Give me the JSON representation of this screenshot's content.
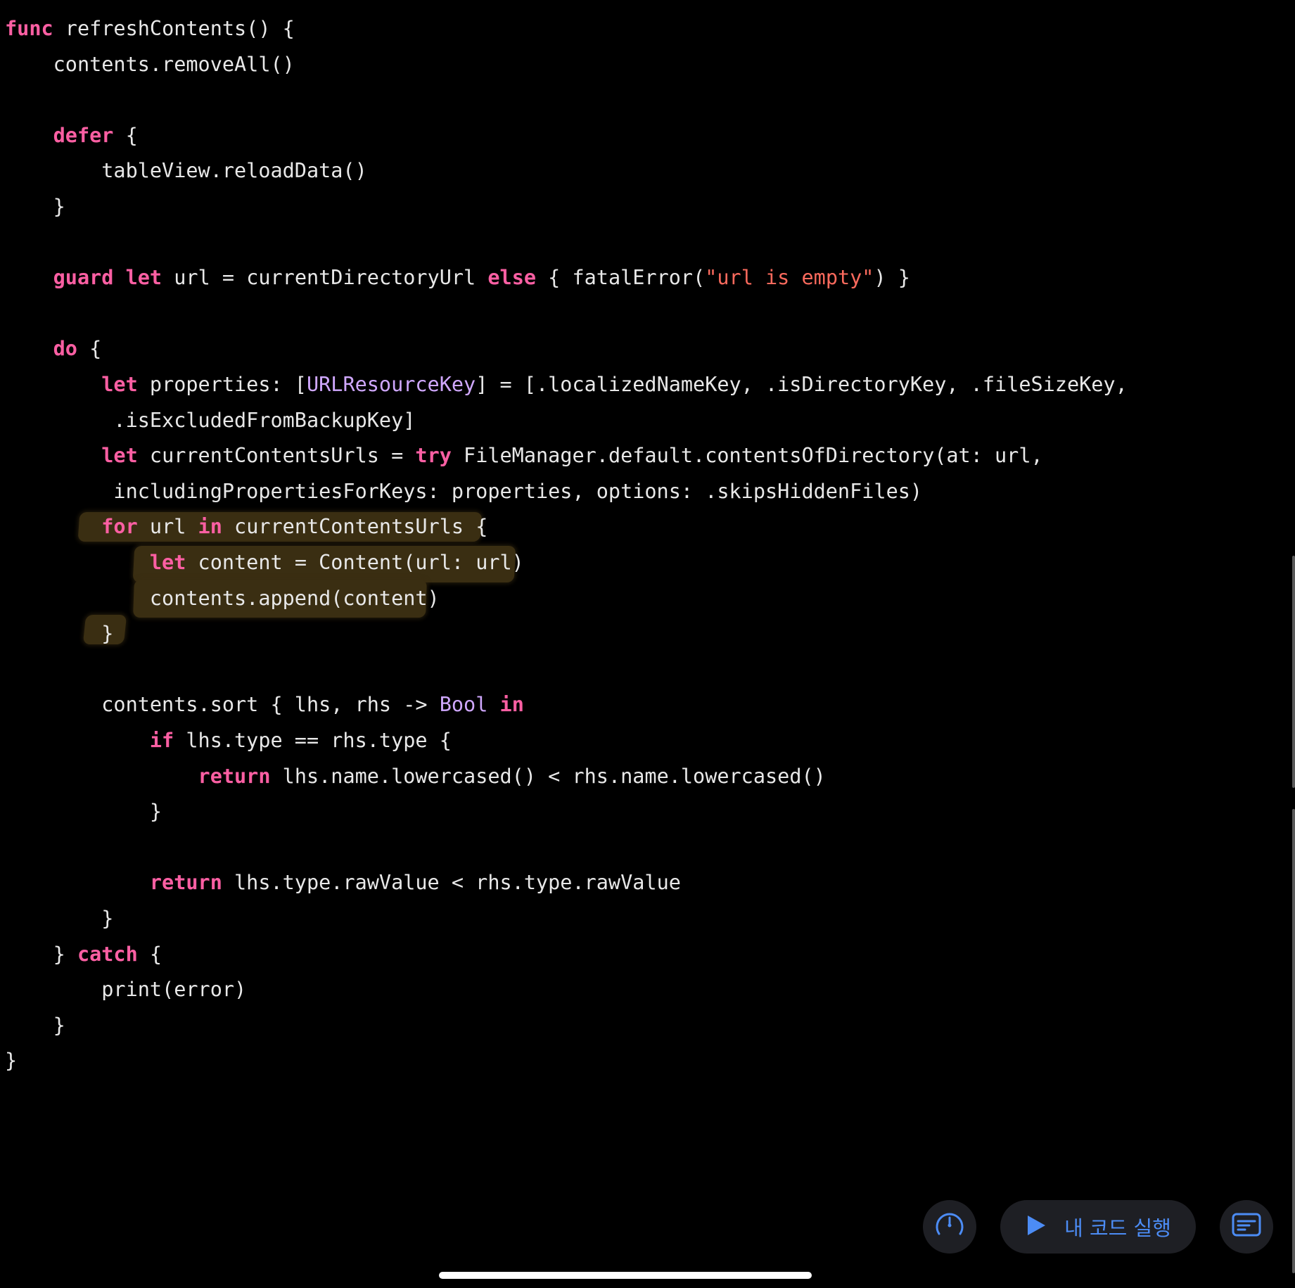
{
  "editor": {
    "lines": [
      [
        [
          "kw",
          "func"
        ],
        [
          "plain",
          " refreshContents() {"
        ]
      ],
      [
        [
          "plain",
          "    contents.removeAll()"
        ]
      ],
      [
        [
          "plain",
          ""
        ]
      ],
      [
        [
          "kw",
          "    defer"
        ],
        [
          "plain",
          " {"
        ]
      ],
      [
        [
          "plain",
          "        tableView.reloadData()"
        ]
      ],
      [
        [
          "plain",
          "    }"
        ]
      ],
      [
        [
          "plain",
          ""
        ]
      ],
      [
        [
          "kw",
          "    guard"
        ],
        [
          "plain",
          " "
        ],
        [
          "kw",
          "let"
        ],
        [
          "plain",
          " url = currentDirectoryUrl "
        ],
        [
          "kw",
          "else"
        ],
        [
          "plain",
          " { fatalError("
        ],
        [
          "str",
          "\"url is empty\""
        ],
        [
          "plain",
          ") }"
        ]
      ],
      [
        [
          "plain",
          ""
        ]
      ],
      [
        [
          "kw",
          "    do"
        ],
        [
          "plain",
          " {"
        ]
      ],
      [
        [
          "kw",
          "        let"
        ],
        [
          "plain",
          " properties: ["
        ],
        [
          "type",
          "URLResourceKey"
        ],
        [
          "plain",
          "] = [.localizedNameKey, .isDirectoryKey, .fileSizeKey,"
        ]
      ],
      [
        [
          "plain",
          "         .isExcludedFromBackupKey]"
        ]
      ],
      [
        [
          "kw",
          "        let"
        ],
        [
          "plain",
          " currentContentsUrls = "
        ],
        [
          "kw",
          "try"
        ],
        [
          "plain",
          " FileManager.default.contentsOfDirectory(at: url,"
        ]
      ],
      [
        [
          "plain",
          "         includingPropertiesForKeys: properties, options: .skipsHiddenFiles)"
        ]
      ],
      [
        [
          "kw",
          "        for"
        ],
        [
          "plain",
          " url "
        ],
        [
          "kw",
          "in"
        ],
        [
          "plain",
          " currentContentsUrls {"
        ]
      ],
      [
        [
          "kw",
          "            let"
        ],
        [
          "plain",
          " content = Content(url: url)"
        ]
      ],
      [
        [
          "plain",
          "            contents.append(content)"
        ]
      ],
      [
        [
          "plain",
          "        }"
        ]
      ],
      [
        [
          "plain",
          ""
        ]
      ],
      [
        [
          "plain",
          "        contents.sort { lhs, rhs -> "
        ],
        [
          "type",
          "Bool"
        ],
        [
          "plain",
          " "
        ],
        [
          "kw",
          "in"
        ]
      ],
      [
        [
          "kw",
          "            if"
        ],
        [
          "plain",
          " lhs.type == rhs.type {"
        ]
      ],
      [
        [
          "kw",
          "                return"
        ],
        [
          "plain",
          " lhs.name.lowercased() < rhs.name.lowercased()"
        ]
      ],
      [
        [
          "plain",
          "            }"
        ]
      ],
      [
        [
          "plain",
          ""
        ]
      ],
      [
        [
          "kw",
          "            return"
        ],
        [
          "plain",
          " lhs.type.rawValue < rhs.type.rawValue"
        ]
      ],
      [
        [
          "plain",
          "        }"
        ]
      ],
      [
        [
          "plain",
          "    } "
        ],
        [
          "kw",
          "catch"
        ],
        [
          "plain",
          " {"
        ]
      ],
      [
        [
          "plain",
          "        print(error)"
        ]
      ],
      [
        [
          "plain",
          "    }"
        ]
      ],
      [
        [
          "plain",
          "}"
        ]
      ]
    ]
  },
  "colors": {
    "keyword": "#fc5fa3",
    "plain": "#e8e8e8",
    "type": "#d0a8ff",
    "string": "#fc6a5d",
    "highlight": "#3a2e12",
    "button_bg": "#1e1f24",
    "accent": "#4c8cf5"
  },
  "toolbar": {
    "speed_icon": "speedometer-icon",
    "run_icon": "play-icon",
    "run_label": "내 코드 실행",
    "notes_icon": "document-icon"
  }
}
